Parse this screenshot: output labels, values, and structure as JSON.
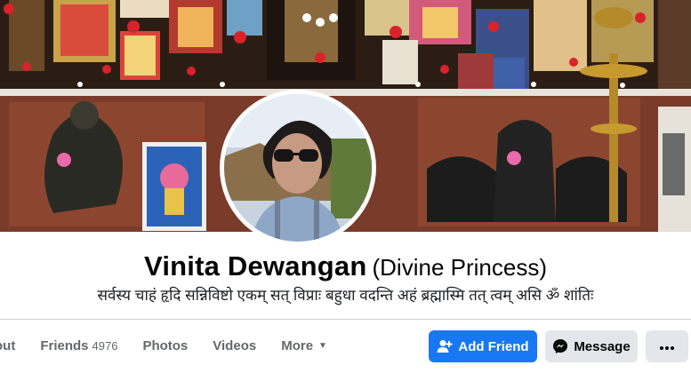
{
  "profile": {
    "name": "Vinita Dewangan",
    "alternate_name": "(Divine Princess)",
    "bio": "सर्वस्य चाहं हृदि सन्निविष्टो एकम् सत् विप्राः बहुधा वदन्ति अहं ब्रह्मास्मि तत् त्वम् असि ॐ शांतिः"
  },
  "nav": {
    "about_partial": "out",
    "friends_label": "Friends",
    "friends_count": "4976",
    "photos_label": "Photos",
    "videos_label": "Videos",
    "more_label": "More"
  },
  "actions": {
    "add_friend_label": "Add Friend",
    "message_label": "Message"
  },
  "icons": {
    "add_friend": "user-plus-icon",
    "message": "messenger-icon",
    "more": "ellipsis-icon",
    "more_nav": "caret-down-icon"
  },
  "colors": {
    "primary": "#1877f2",
    "secondary_button": "#e4e6eb",
    "muted_text": "#65676b"
  }
}
